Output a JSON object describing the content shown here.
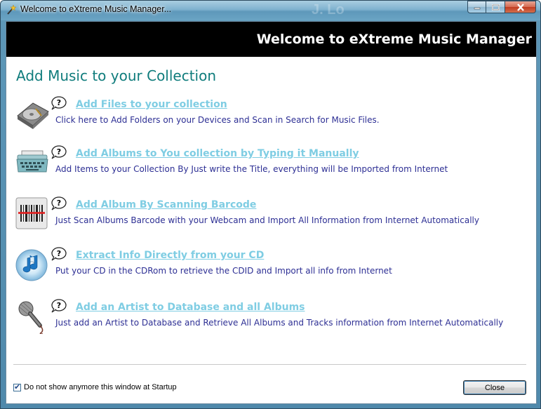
{
  "window": {
    "title": "Welcome to eXtreme Music Manager...",
    "background_ghost_text": "J. Lo"
  },
  "banner": {
    "title": "Welcome to eXtreme Music Manager"
  },
  "heading": "Add Music to your Collection",
  "items": [
    {
      "icon": "hard-drive-icon",
      "link": "Add Files to your collection",
      "description": "Click here to Add Folders on your Devices and Scan in Search for Music Files."
    },
    {
      "icon": "typewriter-icon",
      "link": "Add Albums to You collection by Typing it Manually",
      "description": "Add Items to your Collection By Just write the Title, everything will be Imported from Internet"
    },
    {
      "icon": "barcode-scanner-icon",
      "link": "Add Album By Scanning Barcode",
      "description": "Just Scan Albums Barcode with your Webcam and Import All Information from Internet Automatically"
    },
    {
      "icon": "cd-music-icon",
      "link": "Extract Info Directly from your CD",
      "description": "Put your CD in the CDRom to retrieve the CDID and Import all info from Internet"
    },
    {
      "icon": "microphone-icon",
      "link": "Add an Artist to Database and all Albums",
      "description": "Just add an Artist to Database and Retrieve All Albums and Tracks information from Internet Automatically"
    }
  ],
  "footer": {
    "checkbox_label": "Do not show anymore this window at Startup",
    "checkbox_checked": true,
    "close_label": "Close"
  },
  "colors": {
    "heading": "#0f7c7c",
    "link": "#7fcde3",
    "description": "#2d2f94",
    "banner": "#000000"
  }
}
